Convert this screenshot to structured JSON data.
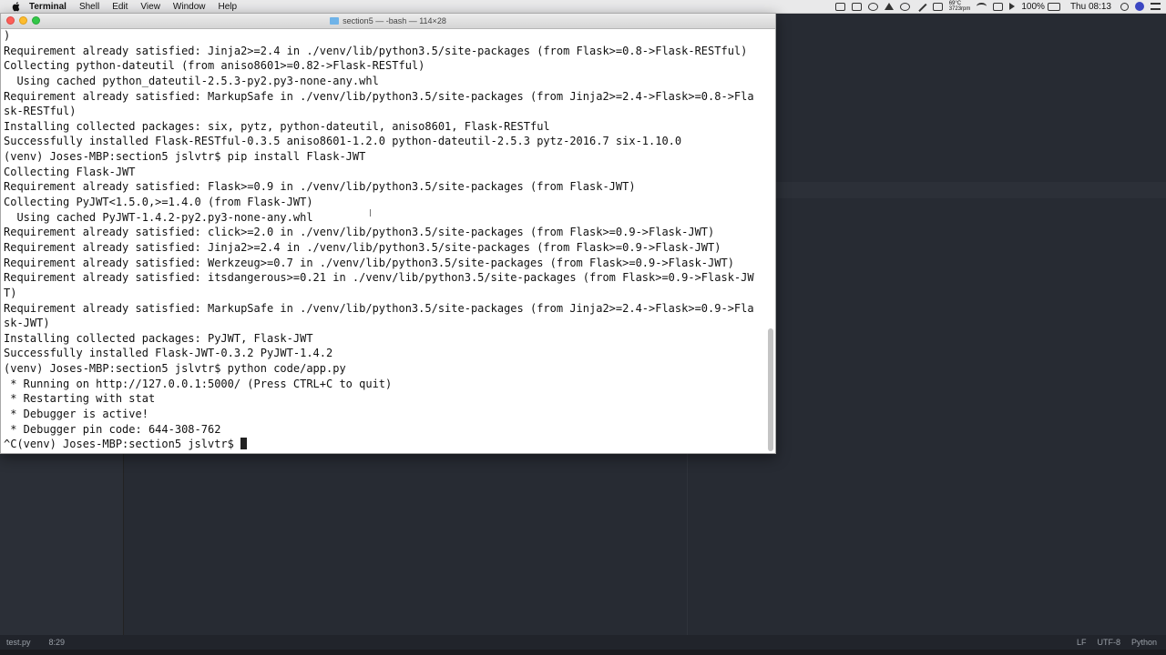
{
  "menubar": {
    "app_name": "Terminal",
    "menus": [
      "Shell",
      "Edit",
      "View",
      "Window",
      "Help"
    ],
    "temp_line1": "69°C",
    "temp_line2": "3723rpm",
    "battery": "100%",
    "clock": "Thu 08:13"
  },
  "window": {
    "title": "section5 — -bash — 114×28"
  },
  "terminal": {
    "lines": [
      ")",
      "Requirement already satisfied: Jinja2>=2.4 in ./venv/lib/python3.5/site-packages (from Flask>=0.8->Flask-RESTful)",
      "Collecting python-dateutil (from aniso8601>=0.82->Flask-RESTful)",
      "  Using cached python_dateutil-2.5.3-py2.py3-none-any.whl",
      "Requirement already satisfied: MarkupSafe in ./venv/lib/python3.5/site-packages (from Jinja2>=2.4->Flask>=0.8->Fla",
      "sk-RESTful)",
      "Installing collected packages: six, pytz, python-dateutil, aniso8601, Flask-RESTful",
      "Successfully installed Flask-RESTful-0.3.5 aniso8601-1.2.0 python-dateutil-2.5.3 pytz-2016.7 six-1.10.0",
      "(venv) Joses-MBP:section5 jslvtr$ pip install Flask-JWT",
      "Collecting Flask-JWT",
      "Requirement already satisfied: Flask>=0.9 in ./venv/lib/python3.5/site-packages (from Flask-JWT)",
      "Collecting PyJWT<1.5.0,>=1.4.0 (from Flask-JWT)",
      "  Using cached PyJWT-1.4.2-py2.py3-none-any.whl",
      "Requirement already satisfied: click>=2.0 in ./venv/lib/python3.5/site-packages (from Flask>=0.9->Flask-JWT)",
      "Requirement already satisfied: Jinja2>=2.4 in ./venv/lib/python3.5/site-packages (from Flask>=0.9->Flask-JWT)",
      "Requirement already satisfied: Werkzeug>=0.7 in ./venv/lib/python3.5/site-packages (from Flask>=0.9->Flask-JWT)",
      "Requirement already satisfied: itsdangerous>=0.21 in ./venv/lib/python3.5/site-packages (from Flask>=0.9->Flask-JW",
      "T)",
      "Requirement already satisfied: MarkupSafe in ./venv/lib/python3.5/site-packages (from Jinja2>=2.4->Flask>=0.9->Fla",
      "sk-JWT)",
      "Installing collected packages: PyJWT, Flask-JWT",
      "Successfully installed Flask-JWT-0.3.2 PyJWT-1.4.2",
      "(venv) Joses-MBP:section5 jslvtr$ python code/app.py",
      " * Running on http://127.0.0.1:5000/ (Press CTRL+C to quit)",
      " * Restarting with stat",
      " * Debugger is active!",
      " * Debugger pin code: 644-308-762"
    ],
    "prompt": "^C(venv) Joses-MBP:section5 jslvtr$ "
  },
  "editor_status": {
    "filename": "test.py",
    "cursor_pos": "8:29",
    "line_ending": "LF",
    "encoding": "UTF-8",
    "grammar": "Python"
  }
}
